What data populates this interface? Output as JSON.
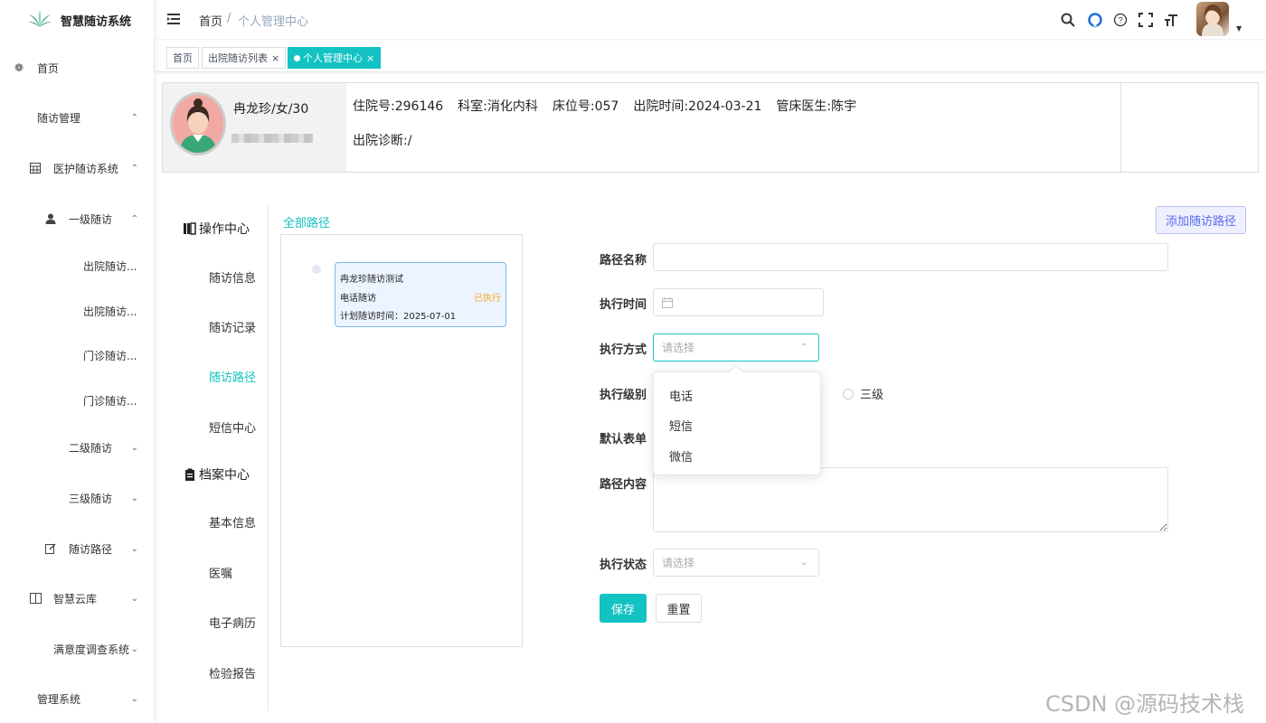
{
  "app": {
    "title": "智慧随访系统"
  },
  "colors": {
    "accent": "#13c2c2",
    "pending": "#f5a623",
    "add_button": "#5a6cf0"
  },
  "sidebar": {
    "items": [
      {
        "label": "首页",
        "icon": "dashboard-icon"
      },
      {
        "label": "随访管理"
      },
      {
        "label": "医护随访系统",
        "icon": "table-icon"
      },
      {
        "label": "一级随访",
        "icon": "user-icon"
      },
      {
        "label": "出院随访..."
      },
      {
        "label": "出院随访..."
      },
      {
        "label": "门诊随访..."
      },
      {
        "label": "门诊随访..."
      },
      {
        "label": "二级随访"
      },
      {
        "label": "三级随访"
      },
      {
        "label": "随访路径",
        "icon": "edit-icon"
      },
      {
        "label": "智慧云库",
        "icon": "book-icon"
      },
      {
        "label": "满意度调查系统"
      },
      {
        "label": "管理系统"
      }
    ]
  },
  "breadcrumb": {
    "home": "首页",
    "separator": "/",
    "current": "个人管理中心"
  },
  "tags": [
    {
      "label": "首页"
    },
    {
      "label": "出院随访列表",
      "close": "×"
    },
    {
      "label": "个人管理中心",
      "close": "×"
    }
  ],
  "patient": {
    "name_info": "冉龙珍/女/30",
    "admission_no": "住院号:296146",
    "department": "科室:消化内科",
    "bed": "床位号:057",
    "discharge_time": "出院时间:2024-03-21",
    "doctor": "管床医生:陈宇",
    "diagnosis": "出院诊断:/"
  },
  "subnav": {
    "operation_title": "操作中心",
    "operation_items": [
      "随访信息",
      "随访记录",
      "随访路径",
      "短信中心"
    ],
    "archive_title": "档案中心",
    "archive_items": [
      "基本信息",
      "医嘱",
      "电子病历",
      "检验报告"
    ]
  },
  "paths": {
    "all_label": "全部路径",
    "card": {
      "title": "冉龙珍随访测试",
      "method": "电话随访",
      "status": "已执行",
      "plan_time": "计划随访时间：2025-07-01"
    }
  },
  "add_button": "添加随访路径",
  "form": {
    "path_name_label": "路径名称",
    "path_name_value": "",
    "exec_time_label": "执行时间",
    "exec_method_label": "执行方式",
    "exec_method_placeholder": "请选择",
    "exec_level_label": "执行级别",
    "level_option_3": "三级",
    "default_form_label": "默认表单",
    "path_content_label": "路径内容",
    "path_content_value": "",
    "exec_status_label": "执行状态",
    "exec_status_placeholder": "请选择",
    "save": "保存",
    "reset": "重置"
  },
  "dropdown_options": [
    "电话",
    "短信",
    "微信"
  ],
  "watermark": "CSDN @源码技术栈"
}
